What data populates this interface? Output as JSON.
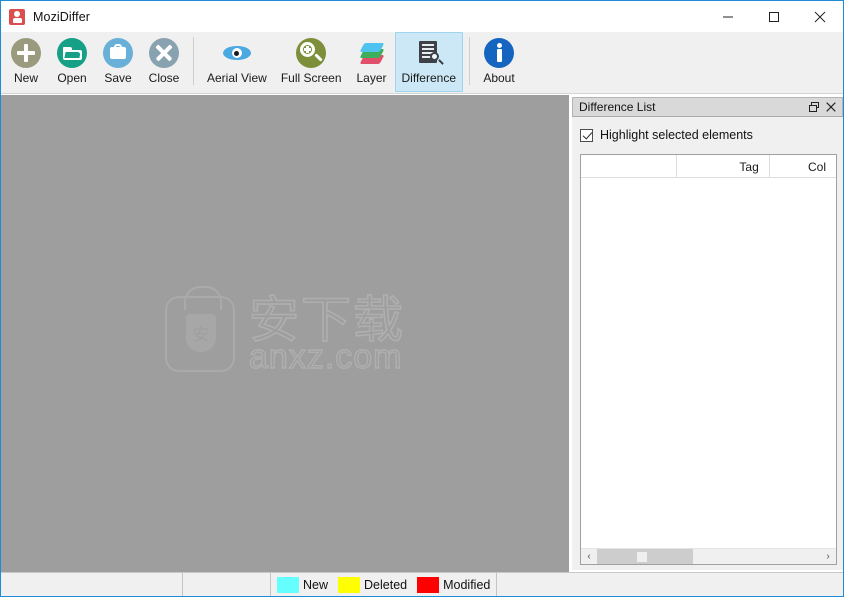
{
  "window": {
    "title": "MoziDiffer",
    "icon": "app-logo-icon",
    "controls": {
      "minimize": "minimize-icon",
      "maximize": "maximize-icon",
      "close": "close-icon"
    }
  },
  "toolbar": {
    "items": [
      {
        "label": "New",
        "icon": "new-document-icon"
      },
      {
        "label": "Open",
        "icon": "open-folder-icon"
      },
      {
        "label": "Save",
        "icon": "save-disk-icon"
      },
      {
        "label": "Close",
        "icon": "close-circle-icon"
      },
      {
        "label": "Aerial View",
        "icon": "eye-icon"
      },
      {
        "label": "Full Screen",
        "icon": "magnifier-plus-icon"
      },
      {
        "label": "Layer",
        "icon": "layers-icon"
      },
      {
        "label": "Difference",
        "icon": "difference-document-icon",
        "selected": true
      },
      {
        "label": "About",
        "icon": "info-icon"
      }
    ]
  },
  "canvas": {
    "watermark": {
      "chinese": "安下载",
      "latin": "anxz.com",
      "bag_glyph": "安"
    }
  },
  "panel": {
    "title": "Difference List",
    "float_button": "restore-window-icon",
    "close_button": "close-icon",
    "checkbox": {
      "label": "Highlight selected elements",
      "checked": true
    },
    "table": {
      "columns": [
        "",
        "Tag",
        "Col"
      ],
      "rows": []
    },
    "scrollbar": {
      "left_arrow": "‹",
      "right_arrow": "›"
    }
  },
  "statusbar": {
    "segment_1": "",
    "segment_2": "",
    "legend": [
      {
        "label": "New",
        "color": "#66FFFF"
      },
      {
        "label": "Deleted",
        "color": "#FFFF00"
      },
      {
        "label": "Modified",
        "color": "#FF0000"
      }
    ]
  },
  "colors": {
    "accent_border": "#1e8bd4",
    "canvas_background": "#9e9e9e",
    "toolbar_background": "#f0f0f0",
    "selection_highlight": "#cce8f7"
  }
}
